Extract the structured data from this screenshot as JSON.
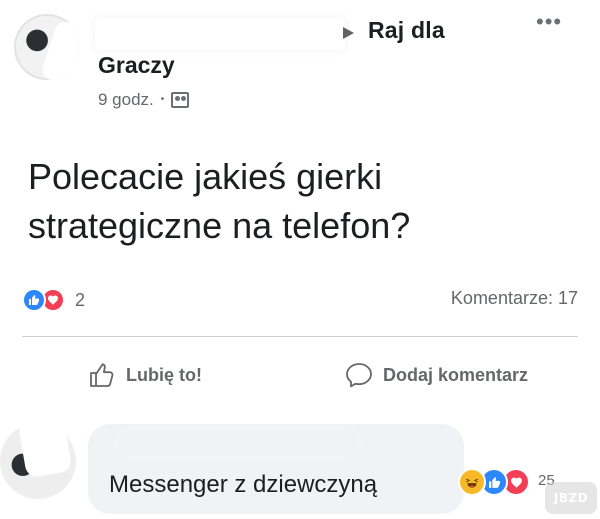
{
  "post": {
    "group_name_part1": "Raj dla",
    "group_name_part2": "Graczy",
    "time": "9 godz.",
    "separator": "•",
    "privacy_icon": "group-members-icon",
    "more_icon": "more-options-icon",
    "text": "Polecacie jakieś gierki strategiczne na telefon?",
    "reaction_count": "2",
    "comments_label": "Komentarze: 17"
  },
  "actions": {
    "like_label": "Lubię to!",
    "comment_label": "Dodaj komentarz"
  },
  "comment": {
    "text": "Messenger z dziewczyną",
    "reaction_count": "25"
  },
  "watermark": {
    "text": "JBZD"
  },
  "colors": {
    "like": "#2d88ff",
    "love": "#f33e58",
    "haha": "#f7b928",
    "secondary_text": "#65676b",
    "comment_bubble": "#f0f2f5"
  }
}
